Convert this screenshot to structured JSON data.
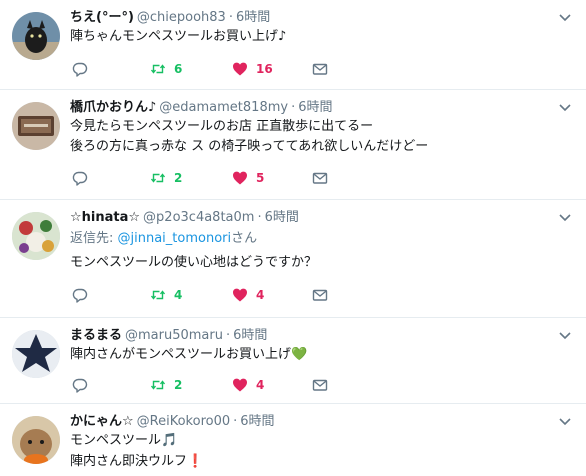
{
  "tweets": [
    {
      "name": "ちえ(°ー°)",
      "handle": "@chiepooh83",
      "time": "6時間",
      "lines": [
        "陣ちゃんモンペスツールお買い上げ♪"
      ],
      "retweets": "6",
      "likes": "16"
    },
    {
      "name": "橋爪かおりん♪",
      "handle": "@edamamet818my",
      "time": "6時間",
      "lines": [
        "今見たらモンペスツールのお店 正直散歩に出てるー",
        " 後ろの方に真っ赤な ス  の椅子映っててあれ欲しいんだけどー"
      ],
      "retweets": "2",
      "likes": "5"
    },
    {
      "name": "☆hinata☆",
      "handle": "@p2o3c4a8ta0m",
      "time": "6時間",
      "reply_prefix": "返信先: ",
      "reply_mention": "@jinnai_tomonori",
      "reply_suffix": "さん",
      "lines": [
        "モンペスツールの使い心地はどうですか？"
      ],
      "retweets": "4",
      "likes": "4"
    },
    {
      "name": "まるまる",
      "handle": "@maru50maru",
      "time": "6時間",
      "lines": [
        "陣内さんがモンペスツールお買い上げ💚"
      ],
      "retweets": "2",
      "likes": "4"
    },
    {
      "name": "かにゃん☆",
      "handle": "@ReiKokoro00",
      "time": "6時間",
      "lines": [
        "モンペスツール🎵",
        "陣内さん即決ウルフ❗"
      ]
    }
  ],
  "separator": "·",
  "colors": {
    "retweet": "#17bf63",
    "like": "#e0245e",
    "icon_gray": "#657786",
    "mention": "#1b95e0"
  }
}
